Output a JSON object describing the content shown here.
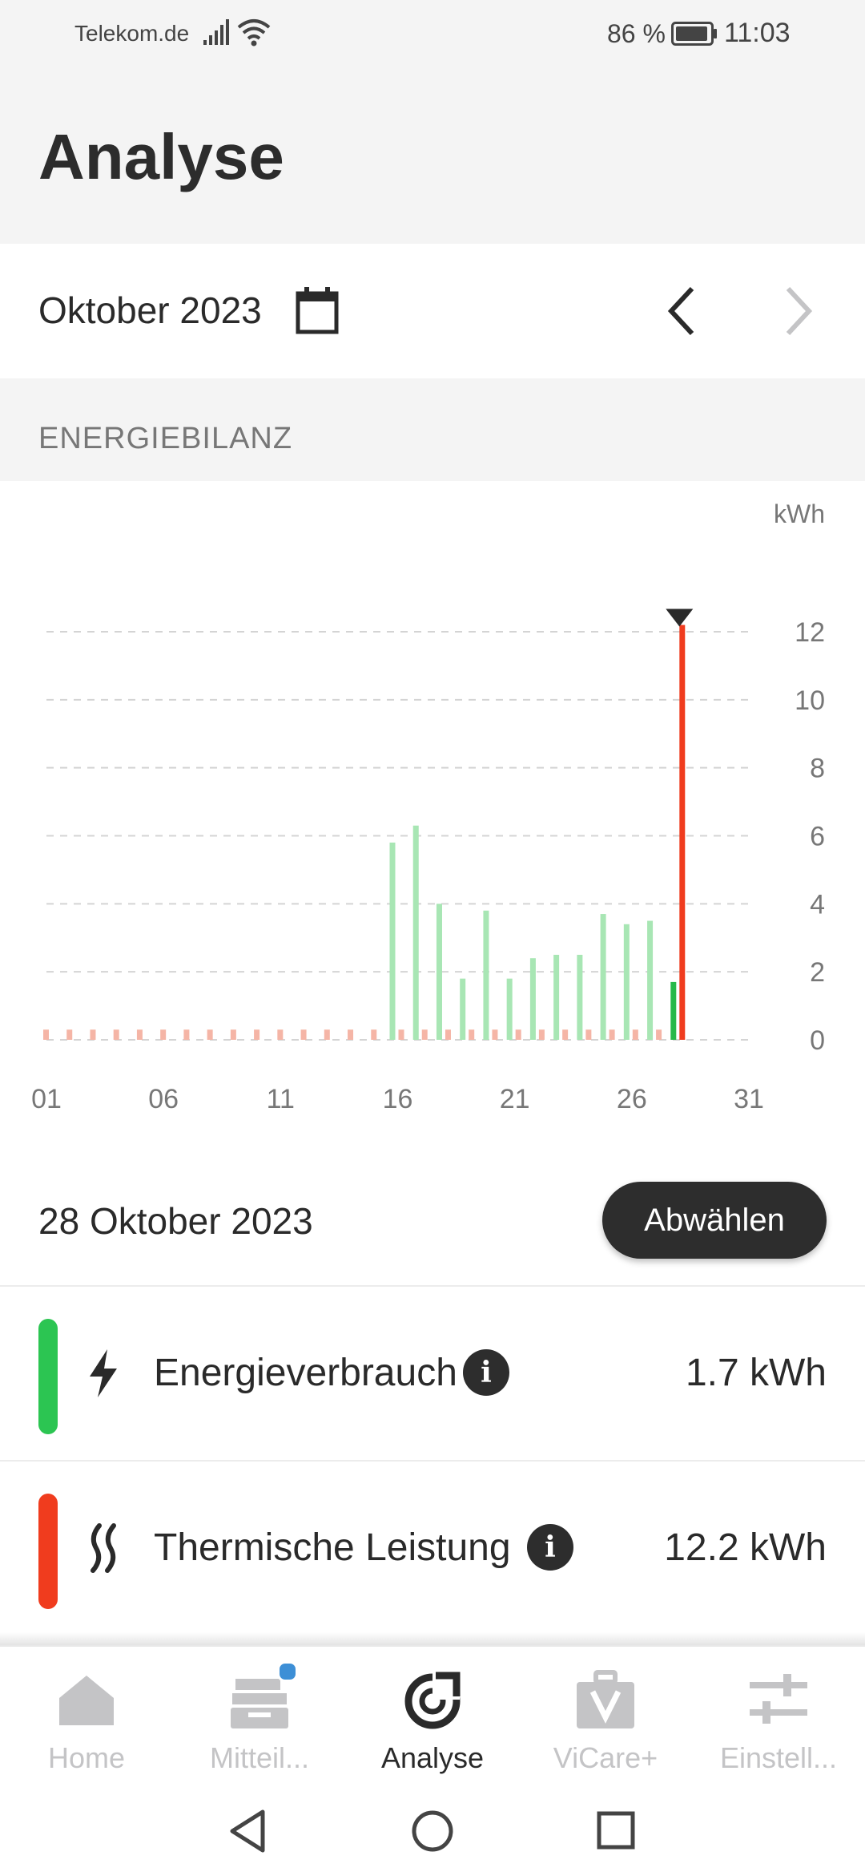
{
  "status_bar": {
    "carrier": "Telekom.de",
    "battery_percent": "86 %",
    "time": "11:03"
  },
  "header": {
    "title": "Analyse"
  },
  "period": {
    "label": "Oktober 2023"
  },
  "section": {
    "title": "ENERGIEBILANZ"
  },
  "chart_data": {
    "type": "bar",
    "ylabel": "kWh",
    "ylim": [
      0,
      12
    ],
    "y_ticks": [
      "0",
      "2",
      "4",
      "6",
      "8",
      "10",
      "12"
    ],
    "x_ticks": [
      "01",
      "06",
      "11",
      "16",
      "21",
      "26",
      "31"
    ],
    "grid": true,
    "days": [
      1,
      2,
      3,
      4,
      5,
      6,
      7,
      8,
      9,
      10,
      11,
      12,
      13,
      14,
      15,
      16,
      17,
      18,
      19,
      20,
      21,
      22,
      23,
      24,
      25,
      26,
      27,
      28
    ],
    "series": [
      {
        "values": [
          0,
          0,
          0,
          0,
          0,
          0,
          0,
          0,
          0,
          0,
          0,
          0,
          0,
          0,
          0,
          5.8,
          6.3,
          4.0,
          1.8,
          3.8,
          1.8,
          2.4,
          2.5,
          2.5,
          3.7,
          3.4,
          3.5,
          1.7
        ],
        "color": "#a8e6b4",
        "selected_color": "#27b94a"
      },
      {
        "values": [
          0.3,
          0.3,
          0.3,
          0.3,
          0.3,
          0.3,
          0.3,
          0.3,
          0.3,
          0.3,
          0.3,
          0.3,
          0.3,
          0.3,
          0.3,
          0.3,
          0.3,
          0.3,
          0.3,
          0.3,
          0.3,
          0.3,
          0.3,
          0.3,
          0.3,
          0.3,
          0.3,
          12.2
        ],
        "color": "#f5b5a6",
        "selected_color": "#f03c1e"
      }
    ],
    "selected_day": 28
  },
  "selection": {
    "date": "28 Oktober 2023",
    "deselect_label": "Abwählen"
  },
  "metrics": [
    {
      "label": "Energieverbrauch",
      "value": "1.7 kWh",
      "color": "#2cc552",
      "icon": "lightning-icon"
    },
    {
      "label": "Thermische Leistung",
      "value": "12.2 kWh",
      "color": "#f03c1e",
      "icon": "heat-waves-icon"
    }
  ],
  "nav": [
    {
      "label": "Home",
      "icon": "home-icon",
      "active": false
    },
    {
      "label": "Mitteil...",
      "icon": "messages-icon",
      "active": false,
      "badge": true
    },
    {
      "label": "Analyse",
      "icon": "analysis-icon",
      "active": true
    },
    {
      "label": "ViCare+",
      "icon": "vicare-plus-icon",
      "active": false
    },
    {
      "label": "Einstell...",
      "icon": "settings-sliders-icon",
      "active": false
    }
  ]
}
